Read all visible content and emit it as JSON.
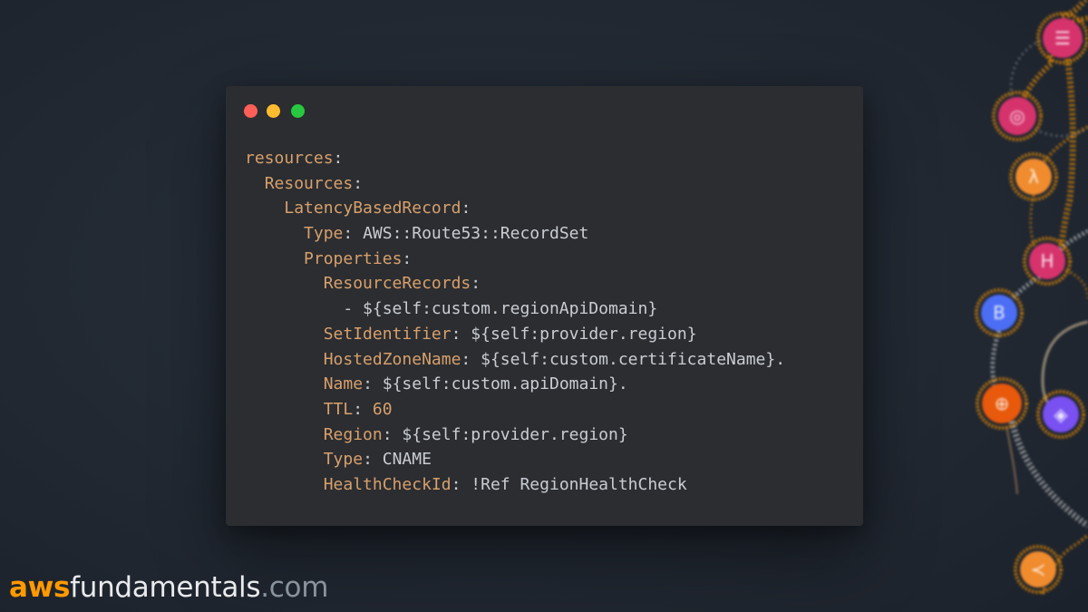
{
  "window": {
    "controls": {
      "close": "window-close",
      "minimize": "window-minimize",
      "zoom": "window-zoom"
    },
    "code_lines": [
      [
        {
          "t": "k",
          "s": "resources"
        },
        {
          "t": "p",
          "s": ":"
        }
      ],
      [
        {
          "t": "p",
          "s": "  "
        },
        {
          "t": "k",
          "s": "Resources"
        },
        {
          "t": "p",
          "s": ":"
        }
      ],
      [
        {
          "t": "p",
          "s": "    "
        },
        {
          "t": "k",
          "s": "LatencyBasedRecord"
        },
        {
          "t": "p",
          "s": ":"
        }
      ],
      [
        {
          "t": "p",
          "s": "      "
        },
        {
          "t": "k",
          "s": "Type"
        },
        {
          "t": "p",
          "s": ": "
        },
        {
          "t": "v",
          "s": "AWS::Route53::RecordSet"
        }
      ],
      [
        {
          "t": "p",
          "s": "      "
        },
        {
          "t": "k",
          "s": "Properties"
        },
        {
          "t": "p",
          "s": ":"
        }
      ],
      [
        {
          "t": "p",
          "s": "        "
        },
        {
          "t": "k",
          "s": "ResourceRecords"
        },
        {
          "t": "p",
          "s": ":"
        }
      ],
      [
        {
          "t": "p",
          "s": "          - "
        },
        {
          "t": "v",
          "s": "${self:custom.regionApiDomain}"
        }
      ],
      [
        {
          "t": "p",
          "s": "        "
        },
        {
          "t": "k",
          "s": "SetIdentifier"
        },
        {
          "t": "p",
          "s": ": "
        },
        {
          "t": "v",
          "s": "${self:provider.region}"
        }
      ],
      [
        {
          "t": "p",
          "s": "        "
        },
        {
          "t": "k",
          "s": "HostedZoneName"
        },
        {
          "t": "p",
          "s": ": "
        },
        {
          "t": "v",
          "s": "${self:custom.certificateName}."
        }
      ],
      [
        {
          "t": "p",
          "s": "        "
        },
        {
          "t": "k",
          "s": "Name"
        },
        {
          "t": "p",
          "s": ": "
        },
        {
          "t": "v",
          "s": "${self:custom.apiDomain}."
        }
      ],
      [
        {
          "t": "p",
          "s": "        "
        },
        {
          "t": "k",
          "s": "TTL"
        },
        {
          "t": "p",
          "s": ": "
        },
        {
          "t": "n",
          "s": "60"
        }
      ],
      [
        {
          "t": "p",
          "s": "        "
        },
        {
          "t": "k",
          "s": "Region"
        },
        {
          "t": "p",
          "s": ": "
        },
        {
          "t": "v",
          "s": "${self:provider.region}"
        }
      ],
      [
        {
          "t": "p",
          "s": "        "
        },
        {
          "t": "k",
          "s": "Type"
        },
        {
          "t": "p",
          "s": ": "
        },
        {
          "t": "v",
          "s": "CNAME"
        }
      ],
      [
        {
          "t": "p",
          "s": "        "
        },
        {
          "t": "k",
          "s": "HealthCheckId"
        },
        {
          "t": "p",
          "s": ": "
        },
        {
          "t": "v",
          "s": "!Ref RegionHealthCheck"
        }
      ]
    ]
  },
  "brand": {
    "aws": "aws",
    "name": "fundamentals",
    "tld": ".com"
  },
  "decoration": {
    "nodes": [
      {
        "icon": "api-gateway-icon",
        "color": "#d6336c",
        "glyph": "☰"
      },
      {
        "icon": "eventbridge-icon",
        "color": "#d6336c",
        "glyph": "◎"
      },
      {
        "icon": "lambda-icon",
        "color": "#f08c2e",
        "glyph": "λ"
      },
      {
        "icon": "step-functions-icon",
        "color": "#d6336c",
        "glyph": "H"
      },
      {
        "icon": "cloudformation-icon",
        "color": "#4c6ef5",
        "glyph": "B"
      },
      {
        "icon": "route53-icon",
        "color": "#e8590c",
        "glyph": "⊕"
      },
      {
        "icon": "vpc-icon",
        "color": "#7950f2",
        "glyph": "◈"
      },
      {
        "icon": "sqs-icon",
        "color": "#f08c2e",
        "glyph": "≺"
      }
    ],
    "colors": {
      "accent_orange": "#ff9900",
      "key": "#d7a06b",
      "text": "#c9cdd3"
    }
  }
}
